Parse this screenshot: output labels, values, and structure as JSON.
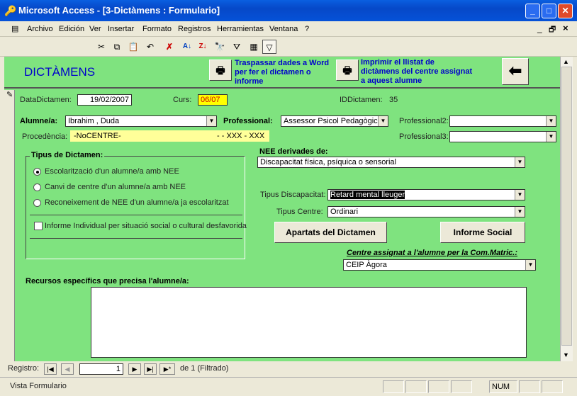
{
  "window": {
    "title": "Microsoft Access - [3-Dictàmens : Formulario]",
    "minimize": "_",
    "maximize": "□",
    "close": "✕"
  },
  "menu": [
    "Archivo",
    "Edición",
    "Ver",
    "Insertar",
    "Formato",
    "Registros",
    "Herramientas",
    "Ventana",
    "?"
  ],
  "toolbar": {
    "icons": [
      "cut-icon",
      "copy-icon",
      "paste-icon",
      "undo-icon",
      "delete-record-icon",
      "sort-asc-icon",
      "sort-desc-icon",
      "find-icon",
      "filter-form-icon",
      "apply-filter-icon",
      "filter-icon"
    ]
  },
  "header": {
    "title": "DICTÀMENS",
    "word_button_text": "Traspassar dades a Word per fer el dictamen o informe",
    "print_button_text": "Imprimir el llistat de dictàmens del centre assignat a aquest alumne"
  },
  "fields": {
    "data_label": "DataDictamen:",
    "data_value": "19/02/2007",
    "curs_label": "Curs:",
    "curs_value": "06/07",
    "id_label": "IDDictamen:",
    "id_value": "35",
    "alumne_label": "Alumne/a:",
    "alumne_value": "Ibrahim , Duda",
    "prof_label": "Professional:",
    "prof_value": "Assessor Psicol Pedagògic",
    "prof2_label": "Professional2:",
    "prof2_value": "",
    "prof3_label": "Professional3:",
    "prof3_value": "",
    "proc_label": "Procedència:",
    "proc_value": "-NoCENTRE-",
    "proc_value2": "- - XXX - XXX",
    "nee_label": "NEE derivades de:",
    "nee_value": "Discapacitat física, psíquica o sensorial",
    "tdisc_label": "Tipus Discapacitat:",
    "tdisc_value": "Retard mental lleuger",
    "tcentre_label": "Tipus Centre:",
    "tcentre_value": "Ordinari",
    "centre_label": "Centre assignat a l'alumne per la Com.Matric.:",
    "centre_value": "CEIP Àgora",
    "recursos_label": "Recursos específics que precisa l'alumne/a:",
    "recursos_value": ""
  },
  "tipus": {
    "title": "Tipus de Dictamen:",
    "options": [
      "Escolarització d'un alumne/a amb NEE",
      "Canvi de centre d'un alumne/a amb NEE",
      "Reconeixement de NEE d'un alumne/a ja escolaritzat"
    ],
    "checkbox": "Informe Individual  per situació social o cultural desfavorida"
  },
  "buttons": {
    "apartats": "Apartats del Dictamen",
    "informe": "Informe Social"
  },
  "nav": {
    "label": "Registro:",
    "current": "1",
    "total_text": "de  1 (Filtrado)"
  },
  "status": {
    "text": "Vista Formulario",
    "num": "NUM"
  },
  "colors": {
    "form_bg": "#7fe37f",
    "title_blue": "#0000cc",
    "curs_bg": "#ffff00",
    "proc_bg": "#ffff99"
  }
}
